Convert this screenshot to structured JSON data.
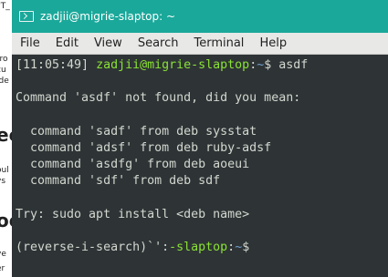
{
  "background_window": {
    "fragments": [
      "?T_",
      "rro",
      "cu",
      "ide",
      "ec",
      "oul",
      "ys",
      "oc",
      "ve",
      "er"
    ]
  },
  "window": {
    "title": "zadjii@migrie-slaptop: ~",
    "menu": [
      "File",
      "Edit",
      "View",
      "Search",
      "Terminal",
      "Help"
    ]
  },
  "terminal": {
    "time": "[11:05:49]",
    "user_host": "zadjii@migrie-slaptop",
    "sep": ":",
    "path": "~",
    "prompt_end": "$",
    "command": "asdf",
    "not_found": "Command 'asdf' not found, did you mean:",
    "suggestions": [
      "  command 'sadf' from deb sysstat",
      "  command 'adsf' from deb ruby-adsf",
      "  command 'asdfg' from deb aoeui",
      "  command 'sdf' from deb sdf"
    ],
    "try": "Try: sudo apt install <deb name>",
    "search_prefix": "(reverse-i-search)`':",
    "search_host": "-slaptop",
    "search_sep": ":",
    "search_path": "~",
    "search_end": "$"
  },
  "colors": {
    "titlebar": "#1aa89a",
    "terminal_bg": "#2e3436",
    "terminal_fg": "#d3d7cf",
    "prompt_green": "#8ae234",
    "path_blue": "#729fcf"
  }
}
